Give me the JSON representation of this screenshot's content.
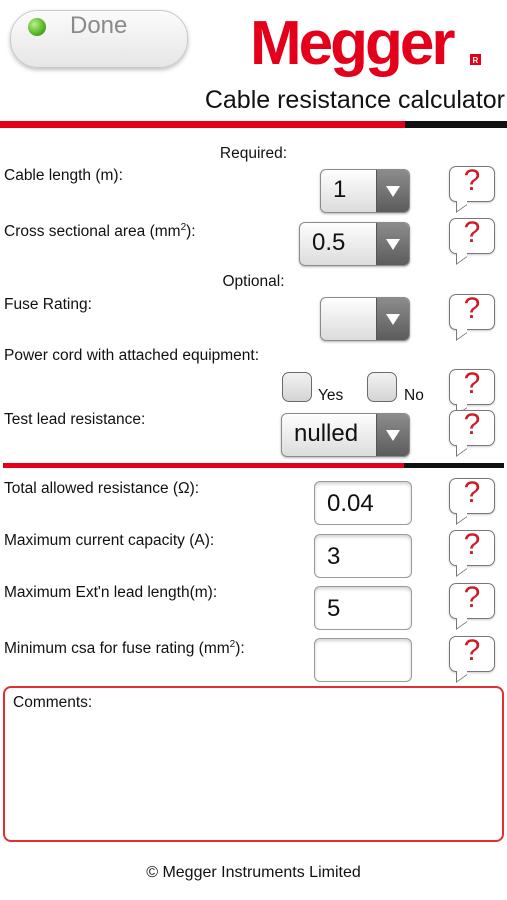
{
  "header": {
    "done_label": "Done",
    "brand": "Megger",
    "brand_mark": "R",
    "title": "Cable resistance calculator"
  },
  "colors": {
    "accent_red": "#e4001b",
    "help_red": "#cc1b26",
    "bar_black": "#111111"
  },
  "required": {
    "heading": "Required:",
    "cable_length": {
      "label": "Cable length (m):",
      "value": "1"
    },
    "csa": {
      "label_pre": "Cross sectional area (mm",
      "label_sup": "2",
      "label_post": "):",
      "value": "0.5"
    }
  },
  "optional": {
    "heading": "Optional:",
    "fuse_rating": {
      "label": "Fuse Rating:",
      "value": ""
    },
    "power_cord": {
      "label": "Power cord with attached equipment:",
      "yes_label": "Yes",
      "no_label": "No"
    },
    "test_lead": {
      "label": "Test lead resistance:",
      "value": "nulled"
    }
  },
  "results": {
    "total_resistance": {
      "label": "Total allowed resistance (Ω):",
      "value": "0.04"
    },
    "max_current": {
      "label": "Maximum current capacity (A):",
      "value": "3"
    },
    "max_ext_length": {
      "label": "Maximum Ext'n lead length(m):",
      "value": "5"
    },
    "min_csa": {
      "label_pre": "Minimum csa for fuse rating (mm",
      "label_sup": "2",
      "label_post": "):",
      "value": ""
    }
  },
  "help_icon_glyph": "?",
  "comments": {
    "label": "Comments:"
  },
  "footer": "© Megger Instruments Limited"
}
